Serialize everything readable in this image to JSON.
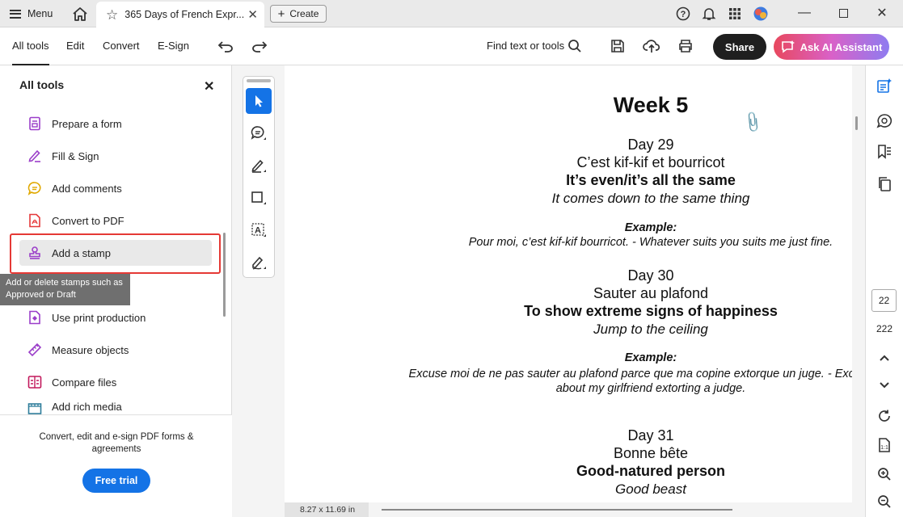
{
  "titlebar": {
    "menu_label": "Menu",
    "tab_title": "365 Days of French Expr...",
    "create_label": "Create"
  },
  "toolbar": {
    "tabs": [
      "All tools",
      "Edit",
      "Convert",
      "E-Sign"
    ],
    "find_label": "Find text or tools",
    "share_label": "Share",
    "ai_label": "Ask AI Assistant"
  },
  "left_panel": {
    "title": "All tools",
    "items": [
      {
        "label": "Prepare a form",
        "icon": "form-icon"
      },
      {
        "label": "Fill & Sign",
        "icon": "pen-sign-icon"
      },
      {
        "label": "Add comments",
        "icon": "comment-icon"
      },
      {
        "label": "Convert to PDF",
        "icon": "pdf-convert-icon"
      },
      {
        "label": "Add a stamp",
        "icon": "stamp-icon"
      },
      {
        "label": "Use print production",
        "icon": "print-production-icon"
      },
      {
        "label": "Measure objects",
        "icon": "ruler-icon"
      },
      {
        "label": "Compare files",
        "icon": "compare-icon"
      },
      {
        "label": "Add rich media",
        "icon": "media-icon"
      }
    ],
    "tooltip": "Add or delete stamps such as Approved or Draft",
    "footer_text": "Convert, edit and e-sign PDF forms & agreements",
    "trial_label": "Free trial"
  },
  "document": {
    "week": "Week 5",
    "days": [
      {
        "day": "Day 29",
        "french": "C’est kif-kif et bourricot",
        "english": "It’s even/it’s all the same",
        "literal": "It comes down to the same thing",
        "example_label": "Example:",
        "example": "Pour moi, c’est kif-kif bourricot. - Whatever suits you suits me just fine."
      },
      {
        "day": "Day 30",
        "french": "Sauter au plafond",
        "english": "To show extreme signs of happiness",
        "literal": "Jump to the ceiling",
        "example_label": "Example:",
        "example": "Excuse moi de ne pas sauter au plafond parce que ma copine extorque un juge. - Excuse me",
        "example_line2": "about my girlfriend extorting a judge."
      },
      {
        "day": "Day 31",
        "french": "Bonne bête",
        "english": "Good-natured person",
        "literal": "Good beast"
      }
    ],
    "page_size": "8.27 x 11.69 in"
  },
  "page_nav": {
    "current": "22",
    "total": "222"
  },
  "colors": {
    "accent": "#1473e6",
    "highlight_border": "#e53935",
    "share_bg": "#1f1f1f"
  }
}
